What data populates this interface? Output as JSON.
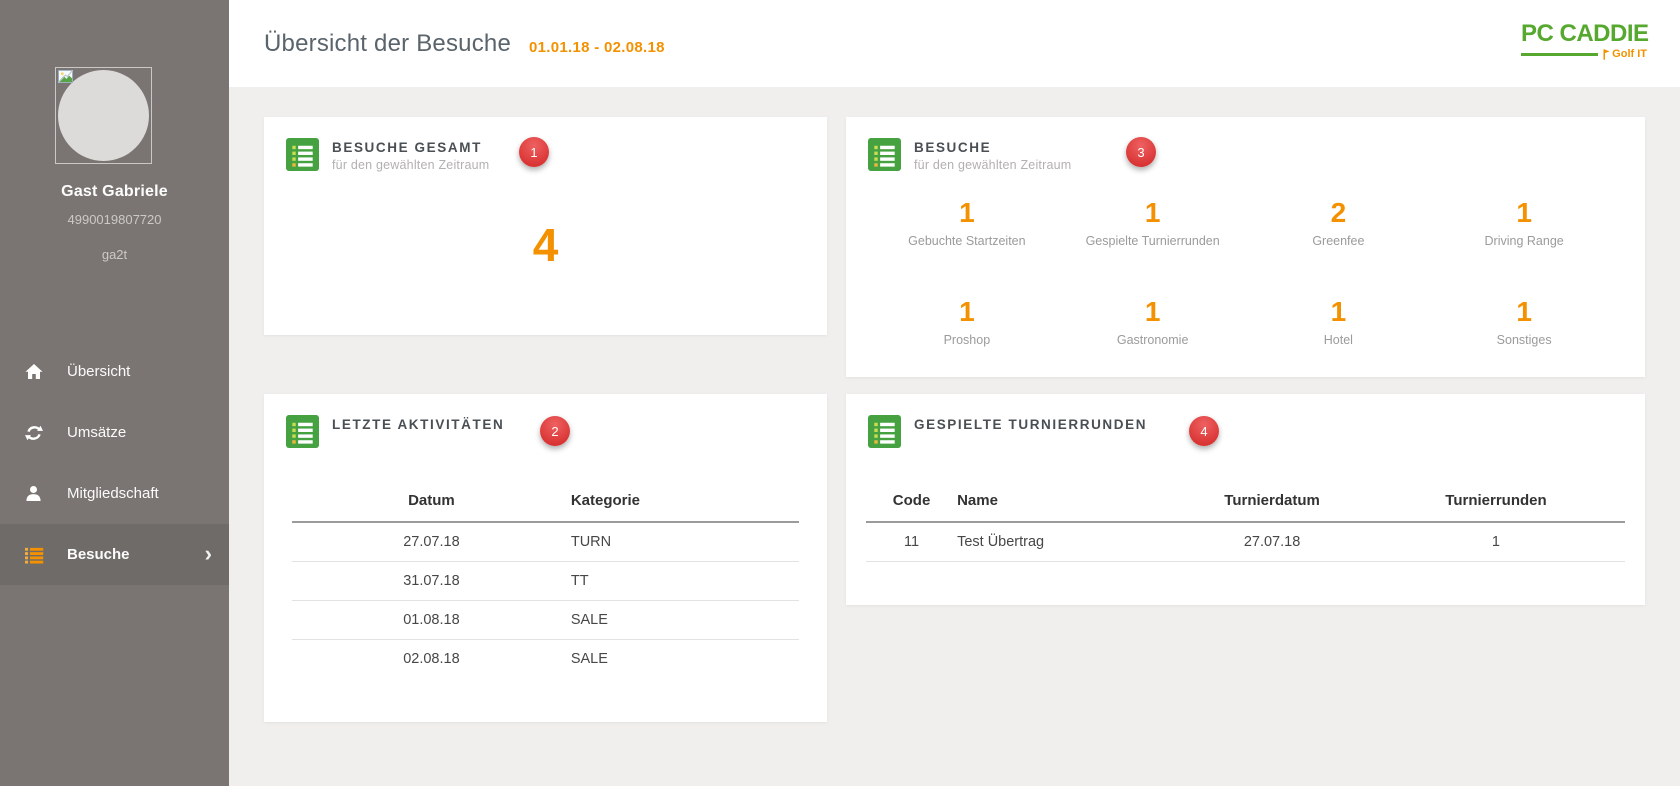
{
  "colors": {
    "accent_orange": "#f39100",
    "icon_green": "#46a241",
    "logo_green": "#56a82f",
    "badge_red": "#d93232",
    "sidebar_bg": "#7a7572",
    "sidebar_active_bg": "#6f6b68"
  },
  "sidebar": {
    "user": {
      "name": "Gast Gabriele",
      "member_id": "4990019807720",
      "username": "ga2t"
    },
    "items": [
      {
        "label": "Übersicht",
        "icon": "home-icon",
        "active": false
      },
      {
        "label": "Umsätze",
        "icon": "sync-icon",
        "active": false
      },
      {
        "label": "Mitgliedschaft",
        "icon": "member-icon",
        "active": false
      },
      {
        "label": "Besuche",
        "icon": "list-icon",
        "active": true,
        "chevron": "›"
      }
    ]
  },
  "header": {
    "title": "Übersicht der Besuche",
    "date_range": "01.01.18 - 02.08.18"
  },
  "logo": {
    "primary": "PC CADDIE",
    "sub": "Golf IT",
    "flag_icon": "golf-flag-icon"
  },
  "cards": {
    "besuche_gesamt": {
      "title": "BESUCHE GESAMT",
      "subtitle": "für den gewählten Zeitraum",
      "badge": "1",
      "total": "4"
    },
    "besuche": {
      "title": "BESUCHE",
      "subtitle": "für den gewählten Zeitraum",
      "badge": "3",
      "stats": [
        {
          "value": "1",
          "label": "Gebuchte Startzeiten"
        },
        {
          "value": "1",
          "label": "Gespielte Turnierrunden"
        },
        {
          "value": "2",
          "label": "Greenfee"
        },
        {
          "value": "1",
          "label": "Driving Range"
        },
        {
          "value": "1",
          "label": "Proshop"
        },
        {
          "value": "1",
          "label": "Gastronomie"
        },
        {
          "value": "1",
          "label": "Hotel"
        },
        {
          "value": "1",
          "label": "Sonstiges"
        }
      ]
    },
    "letzte_aktivitaeten": {
      "title": "LETZTE AKTIVITÄTEN",
      "badge": "2",
      "table": {
        "headers": [
          "Datum",
          "Kategorie"
        ],
        "rows": [
          [
            "27.07.18",
            "TURN"
          ],
          [
            "31.07.18",
            "TT"
          ],
          [
            "01.08.18",
            "SALE"
          ],
          [
            "02.08.18",
            "SALE"
          ]
        ]
      }
    },
    "gespielte_turnierrunden": {
      "title": "GESPIELTE TURNIERRUNDEN",
      "badge": "4",
      "table": {
        "headers": [
          "Code",
          "Name",
          "Turnierdatum",
          "Turnierrunden"
        ],
        "rows": [
          [
            "11",
            "Test Übertrag",
            "27.07.18",
            "1"
          ]
        ]
      }
    }
  }
}
